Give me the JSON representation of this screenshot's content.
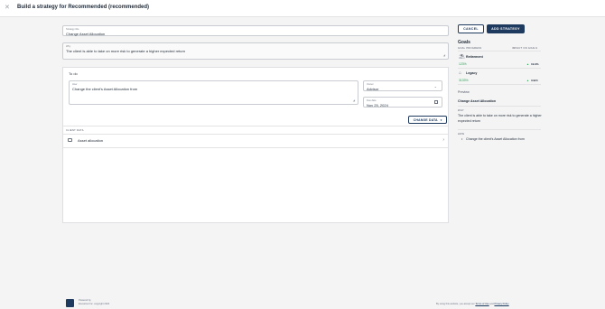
{
  "header": {
    "title": "Build a strategy for Recommended (recommended)",
    "close_icon": "close-icon"
  },
  "form": {
    "strategy_title_label": "Strategy title",
    "strategy_title_value": "Change Asset Allocation",
    "why_label": "Why",
    "why_value": "The client is able to take on more risk to generate a higher expected return"
  },
  "todo": {
    "title": "To do",
    "how_label": "How",
    "how_value": "Change the client's Asset Allocation from",
    "owner_label": "Owner",
    "owner_value": "Advisor",
    "due_label": "Due date",
    "due_value": "Nov 25, 2024",
    "change_data_label": "CHANGE DATA",
    "client_data_label": "CLIENT DATA",
    "asset_allocation_label": "Asset allocation"
  },
  "actions": {
    "cancel_label": "CANCEL",
    "add_strategy_label": "ADD STRATEGY"
  },
  "sidebar": {
    "goals_title": "Goals",
    "goal_progress_label": "GOAL PROGRESS",
    "impact_label": "IMPACT ON GOALS",
    "goals": [
      {
        "name": "Retirement",
        "progress": "123%",
        "impact": "19.9%",
        "icon": "retirement-icon"
      },
      {
        "name": "Legacy",
        "progress": "3133%",
        "impact": "3.924",
        "icon": "legacy-icon"
      }
    ],
    "preview_label": "Preview",
    "preview_title": "Change Asset Allocation",
    "why_label": "WHY",
    "why_text": "The client is able to take on more risk to generate a higher expected return",
    "how_label": "HOW",
    "how_bullet": "Change the client's Asset Allocation from"
  },
  "footer": {
    "powered_by": "Powered by",
    "copyright": "Envestnet Inc. copyright 2024",
    "consent_text": "By using this website, you accept our",
    "terms_label": "Terms of Use",
    "and_text": "and",
    "privacy_label": "Privacy Policy"
  },
  "colors": {
    "primary": "#1f3a5f",
    "positive": "#2e9d54",
    "background": "#f4f4f5"
  }
}
